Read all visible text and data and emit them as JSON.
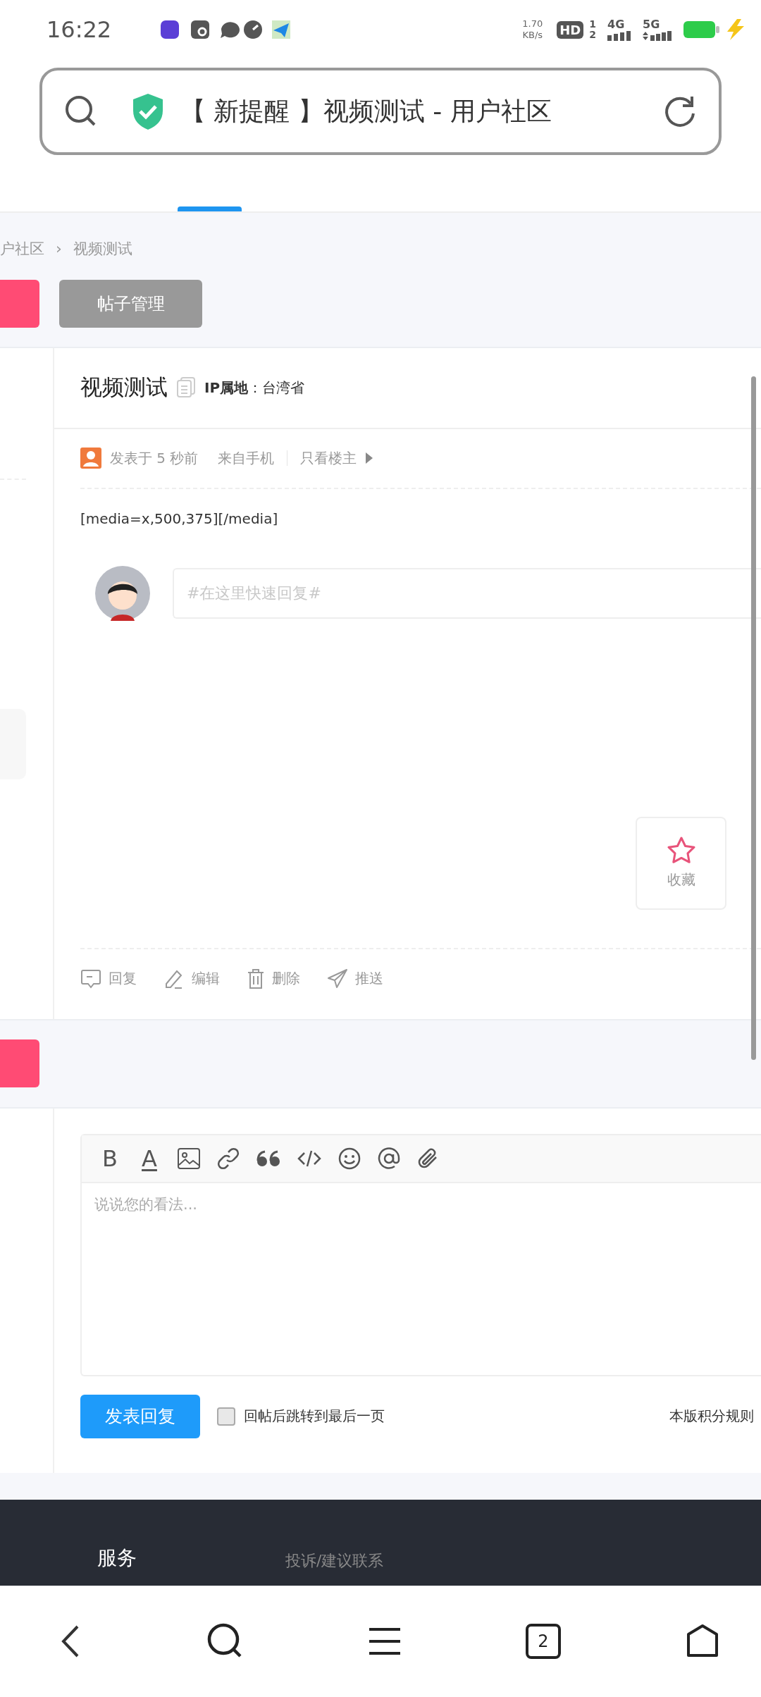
{
  "status_bar": {
    "time": "16:22",
    "net_speed": "1.70",
    "net_unit": "KB/s",
    "hd": "HD",
    "sim_1": "1",
    "sim_2": "2",
    "net_1": "4G",
    "net_2": "5G"
  },
  "address_bar": {
    "title": "【 新提醒 】视频测试 - 用户社区"
  },
  "breadcrumb": [
    "户社区",
    "视频测试"
  ],
  "breadcrumb_separator": "›",
  "manage_button": "帖子管理",
  "post": {
    "title": "视频测试",
    "ip": "**IP属地**：台湾省",
    "posted": "发表于 5 秒前",
    "source": "来自手机",
    "only_author": "只看楼主",
    "body": "[media=x,500,375][/media]",
    "quick_reply_placeholder": "#在这里快速回复#",
    "favorite": "收藏",
    "actions": [
      {
        "kind": "reply",
        "label": "回复"
      },
      {
        "kind": "edit",
        "label": "编辑"
      },
      {
        "kind": "delete",
        "label": "删除"
      },
      {
        "kind": "share",
        "label": "推送"
      }
    ]
  },
  "editor": {
    "bold_glyph": "B",
    "color_glyph": "A",
    "placeholder": "说说您的看法...",
    "submit": "发表回复",
    "jump_last": {
      "label": "回帖后跳转到最后一页",
      "checked": false
    },
    "rules_link": "本版积分规则"
  },
  "footer": {
    "column_1": "服务",
    "column_2": "投诉/建议联系"
  },
  "nav_bar": {
    "tab_count": "2"
  }
}
